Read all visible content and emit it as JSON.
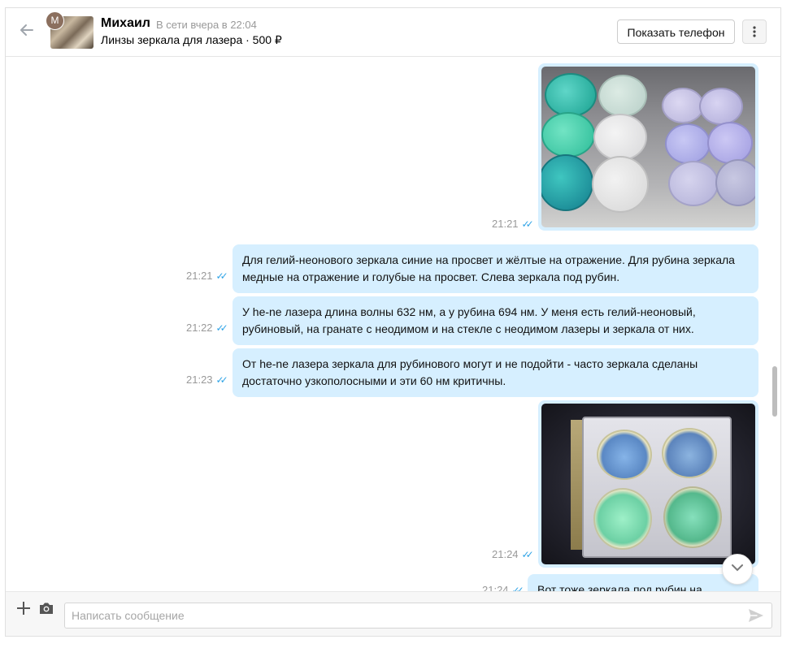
{
  "header": {
    "back_icon": "arrow-left-icon",
    "avatar_letter": "М",
    "user_name": "Михаил",
    "user_status": "В сети вчера в 22:04",
    "listing_title": "Линзы зеркала для лазера · 500 ₽",
    "show_phone_label": "Показать телефон",
    "more_icon": "vertical-dots-icon"
  },
  "messages": [
    {
      "type": "image",
      "time": "21:21",
      "ticks": "✓✓",
      "image_desc_icon": "photo"
    },
    {
      "type": "text",
      "time": "21:21",
      "ticks": "✓✓",
      "text": "Для гелий-неонового зеркала синие на просвет и жёлтые на отражение. Для рубина зеркала медные на отражение и голубые на просвет. Слева зеркала под рубин."
    },
    {
      "type": "text",
      "time": "21:22",
      "ticks": "✓✓",
      "text": "У he-ne лазера длина волны 632 нм, а у рубина 694 нм. У меня есть гелий-неоновый, рубиновый, на гранате с неодимом и на стекле с неодимом лазеры и зеркала от них."
    },
    {
      "type": "text",
      "time": "21:23",
      "ticks": "✓✓",
      "text": "От he-ne лазера зеркала для рубинового могут и не подойти - часто зеркала сделаны достаточно узкополосными и эти 60 нм критичны."
    },
    {
      "type": "image",
      "time": "21:24",
      "ticks": "✓✓"
    },
    {
      "type": "text",
      "time": "21:24",
      "ticks": "✓✓",
      "text": "Вот тоже зеркала под рубин на просвет."
    }
  ],
  "composer": {
    "placeholder": "Написать сообщение",
    "attach_icon": "plus-icon",
    "camera_icon": "camera-icon",
    "send_icon": "send-icon"
  },
  "colors": {
    "bubble": "#d6efff",
    "ticks": "#2ea3e6"
  }
}
